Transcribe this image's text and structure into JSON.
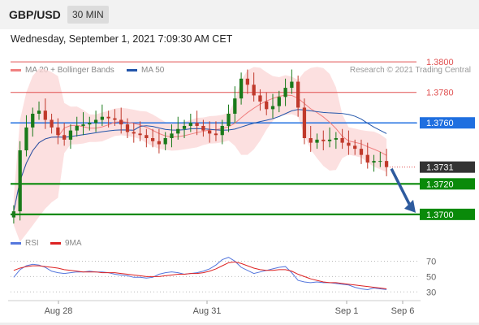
{
  "header": {
    "pair": "GBP/USD",
    "timeframe": "30 MIN"
  },
  "datetime": "Wednesday, September 1, 2021 7:09:30 AM CET",
  "legend": {
    "ma20_label": "MA 20 + Bollinger Bands",
    "ma50_label": "MA 50",
    "rsi_label": "RSI",
    "rsi_ma_label": "9MA"
  },
  "copyright": "Research © 2021 Trading Central",
  "colors": {
    "ma20": "#f08080",
    "ma50": "#2255aa",
    "bollinger": "#fbd5d5",
    "candle_up": "#1a7a1a",
    "candle_down": "#c0392b",
    "support": "#0a8a0a",
    "pivot": "#1f6fe0",
    "resistance": "#e05050",
    "current": "#333333",
    "rsi": "#5577dd",
    "rsi_ma": "#dd2222"
  },
  "chart_data": [
    {
      "type": "candlestick",
      "title": "GBP/USD 30 MIN",
      "ylim": [
        1.3685,
        1.3815
      ],
      "x_ticks": [
        "Aug 28",
        "Aug 31",
        "Sep 1",
        "Sep 6"
      ],
      "levels": [
        {
          "label": "1.3800",
          "value": 1.38,
          "kind": "resistance"
        },
        {
          "label": "1.3780",
          "value": 1.378,
          "kind": "resistance"
        },
        {
          "label": "1.3760",
          "value": 1.376,
          "kind": "pivot"
        },
        {
          "label": "1.3731",
          "value": 1.3731,
          "kind": "current"
        },
        {
          "label": "1.3720",
          "value": 1.372,
          "kind": "support"
        },
        {
          "label": "1.3700",
          "value": 1.37,
          "kind": "support"
        }
      ],
      "close_path": [
        1.3702,
        1.3742,
        1.3757,
        1.3766,
        1.3768,
        1.3762,
        1.3757,
        1.3752,
        1.3749,
        1.3755,
        1.3758,
        1.3759,
        1.376,
        1.3762,
        1.3764,
        1.3763,
        1.3762,
        1.3759,
        1.3754,
        1.3753,
        1.3752,
        1.375,
        1.3748,
        1.3746,
        1.375,
        1.3753,
        1.3756,
        1.3758,
        1.376,
        1.3758,
        1.3755,
        1.3753,
        1.3752,
        1.3758,
        1.3766,
        1.3776,
        1.3789,
        1.3785,
        1.3778,
        1.3774,
        1.3769,
        1.3771,
        1.3777,
        1.3783,
        1.3787,
        1.377,
        1.375,
        1.3747,
        1.3749,
        1.3748,
        1.3749,
        1.375,
        1.3747,
        1.3745,
        1.3743,
        1.3739,
        1.3734,
        1.3735,
        1.3735,
        1.3731
      ],
      "forecast_arrow": {
        "from": 1.3731,
        "to": 1.37
      }
    },
    {
      "type": "line",
      "title": "RSI",
      "ylim": [
        25,
        80
      ],
      "y_ticks": [
        70,
        50,
        30
      ],
      "series": [
        {
          "name": "RSI",
          "values": [
            49,
            59,
            64,
            66,
            65,
            62,
            57,
            55,
            54,
            55,
            56,
            56,
            57,
            56,
            56,
            55,
            53,
            52,
            51,
            49,
            49,
            48,
            49,
            53,
            55,
            56,
            55,
            53,
            54,
            55,
            57,
            60,
            65,
            72,
            75,
            70,
            62,
            58,
            54,
            56,
            58,
            60,
            62,
            63,
            55,
            45,
            43,
            42,
            43,
            42,
            42,
            41,
            40,
            39,
            36,
            34,
            33,
            35,
            34,
            33
          ]
        },
        {
          "name": "9MA",
          "values": [
            58,
            61,
            63,
            64,
            64,
            63,
            62,
            61,
            59,
            58,
            57,
            56,
            56,
            56,
            55,
            55,
            55,
            54,
            53,
            52,
            51,
            50,
            50,
            50,
            51,
            52,
            53,
            53,
            54,
            54,
            55,
            57,
            60,
            64,
            68,
            69,
            67,
            64,
            61,
            59,
            58,
            58,
            59,
            59,
            57,
            53,
            50,
            47,
            45,
            43,
            42,
            42,
            41,
            40,
            39,
            38,
            37,
            36,
            35,
            34
          ]
        }
      ]
    }
  ]
}
